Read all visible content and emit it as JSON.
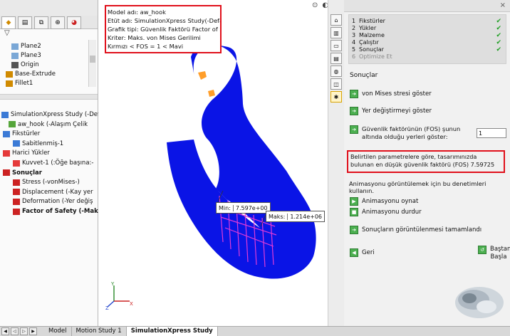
{
  "left_panel": {
    "tree_top": [
      {
        "label": "Plane2",
        "icon": "plane-icon"
      },
      {
        "label": "Plane3",
        "icon": "plane-icon"
      },
      {
        "label": "Origin",
        "icon": "origin-icon"
      },
      {
        "label": "Base-Extrude",
        "icon": "extrude-icon"
      },
      {
        "label": "Fillet1",
        "icon": "fillet-icon"
      }
    ],
    "tree_sim": [
      {
        "label": "SimulationXpress Study (-Defau",
        "bold": false
      },
      {
        "label": "aw_hook (-Alaşım Çelik",
        "bold": false
      },
      {
        "label": "Fikstürler",
        "bold": false
      },
      {
        "label": "Sabitlenmiş-1",
        "bold": false
      },
      {
        "label": "Harici Yükler",
        "bold": false
      },
      {
        "label": "Kuvvet-1 (:Öğe başına:-",
        "bold": false
      },
      {
        "label": "Sonuçlar",
        "bold": true
      },
      {
        "label": "Stress (-vonMises-)",
        "bold": false
      },
      {
        "label": "Displacement (-Kay yer",
        "bold": false
      },
      {
        "label": "Deformation (-Yer değiş",
        "bold": false
      },
      {
        "label": "Factor of Safety (-Mak",
        "bold": true
      }
    ]
  },
  "bottom_tabs": [
    "Model",
    "Motion Study 1",
    "SimulationXpress Study"
  ],
  "viewport": {
    "info_lines": [
      "Model adı: aw_hook",
      "Etüt adı: SimulationXpress Study(-Default-)",
      "Grafik tipi: Güvenlik Faktörü Factor of Safety",
      "Kriter: Maks. von Mises Gerilimi",
      "Kırmızı < FOS = 1 < Mavi"
    ],
    "probe_min_label": "Min:",
    "probe_min_value": "7.597e+00",
    "probe_max_label": "Maks:",
    "probe_max_value": "1.214e+06",
    "axis_labels": [
      "Y",
      "X",
      "Z"
    ]
  },
  "right_panel": {
    "steps": [
      {
        "num": "1",
        "label": "Fikstürler",
        "done": true
      },
      {
        "num": "2",
        "label": "Yükler",
        "done": true
      },
      {
        "num": "3",
        "label": "Malzeme",
        "done": true
      },
      {
        "num": "4",
        "label": "Çalıştır",
        "done": true
      },
      {
        "num": "5",
        "label": "Sonuçlar",
        "done": true
      },
      {
        "num": "6",
        "label": "Optimize Et",
        "done": false
      }
    ],
    "section_title": "Sonuçlar",
    "show_vonmises": "von Mises stresi göster",
    "show_displacement": "Yer değiştirmeyi göster",
    "fos_text": "Güvenlik faktörünün (FOS) şunun altında olduğu yerleri göster:",
    "fos_value": "1",
    "result_text": "Belirtilen parametrelere göre, tasarımınızda bulunan en düşük güvenlik faktörü (FOS) 7.59725",
    "anim_note": "Animasyonu görüntülemek için bu denetimleri kullanın.",
    "play_anim": "Animasyonu oynat",
    "stop_anim": "Animasyonu durdur",
    "done_viewing": "Sonuçların görüntülenmesi tamamlandı",
    "back": "Geri",
    "restart": "Baştan Başla"
  },
  "colors": {
    "part_blue": "#0a14e6",
    "highlight_red": "#e0101b",
    "check_green": "#1e9e22",
    "arrow_magenta": "#e23bd6"
  }
}
